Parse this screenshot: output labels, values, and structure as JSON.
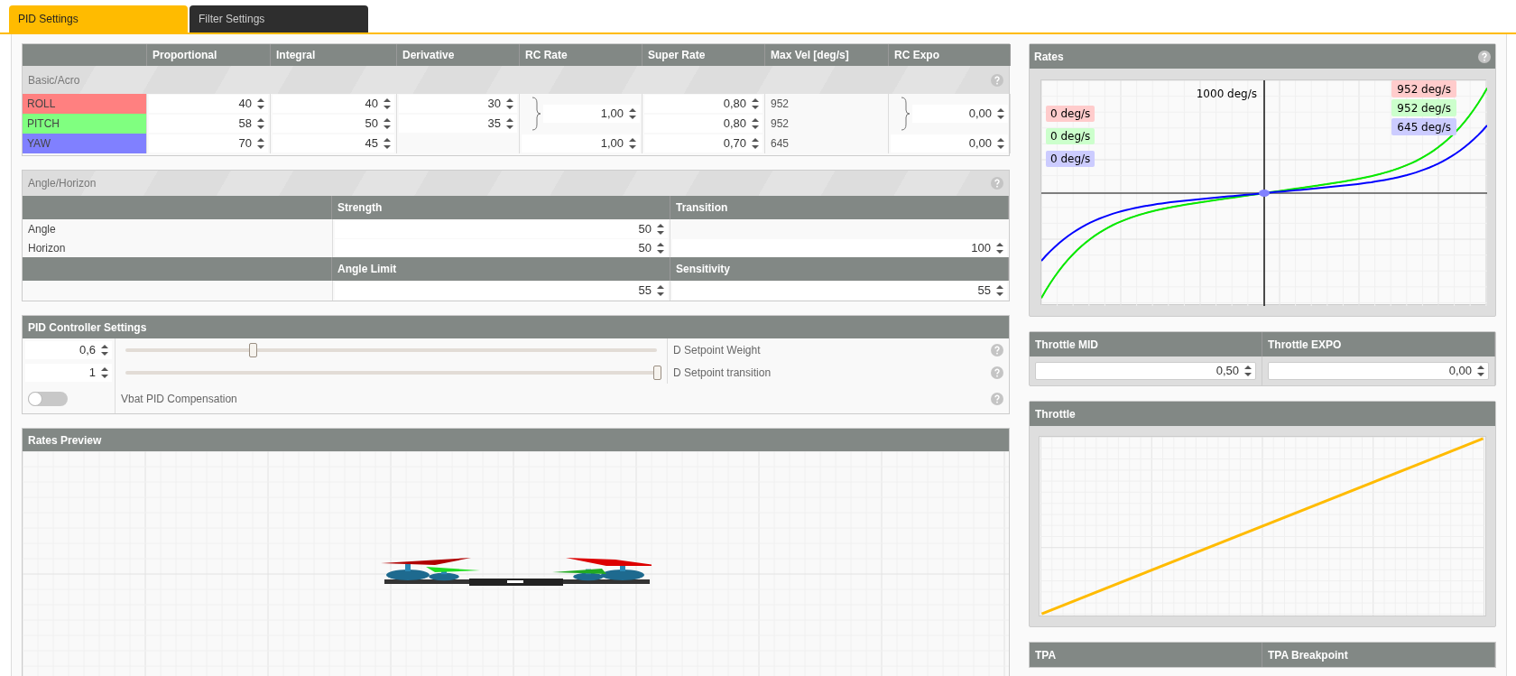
{
  "tabs": [
    {
      "label": "PID Settings",
      "selected": true
    },
    {
      "label": "Filter Settings",
      "selected": false
    }
  ],
  "pid_table": {
    "columns": [
      "Proportional",
      "Integral",
      "Derivative",
      "RC Rate",
      "Super Rate",
      "Max Vel [deg/s]",
      "RC Expo"
    ],
    "section": "Basic/Acro",
    "rows": [
      {
        "axis": "ROLL",
        "color": "#ff8080",
        "proportional": "40",
        "integral": "40",
        "derivative": "30",
        "super_rate": "0,80",
        "max_vel": "952"
      },
      {
        "axis": "PITCH",
        "color": "#80ff80",
        "proportional": "58",
        "integral": "50",
        "derivative": "35",
        "super_rate": "0,80",
        "max_vel": "952"
      },
      {
        "axis": "YAW",
        "color": "#8080ff",
        "proportional": "70",
        "integral": "45",
        "super_rate": "0,70",
        "max_vel": "645"
      }
    ],
    "rc_rate": {
      "roll_pitch": "1,00",
      "yaw": "1,00"
    },
    "rc_expo": {
      "roll_pitch": "0,00",
      "yaw": "0,00"
    }
  },
  "angle_horizon": {
    "title": "Angle/Horizon",
    "columns": [
      "Strength",
      "Transition"
    ],
    "rows": [
      {
        "label": "Angle",
        "strength": "50"
      },
      {
        "label": "Horizon",
        "strength": "50",
        "transition": "100"
      }
    ],
    "limit_columns": [
      "Angle Limit",
      "Sensitivity"
    ],
    "limits": {
      "angle_limit": "55",
      "sensitivity": "55"
    }
  },
  "pid_controller": {
    "title": "PID Controller Settings",
    "items": [
      {
        "kind": "slider",
        "value": "0,6",
        "level": 0.24,
        "label": "D Setpoint Weight"
      },
      {
        "kind": "slider",
        "value": "1",
        "level": 1.0,
        "label": "D Setpoint transition"
      },
      {
        "kind": "toggle",
        "on": false,
        "label": "Vbat PID Compensation"
      }
    ]
  },
  "rates_preview": {
    "title": "Rates Preview"
  },
  "rates": {
    "title": "Rates",
    "axis_label": "1000 deg/s",
    "left_labels": [
      {
        "text": "0 deg/s",
        "color": "#ffcccc"
      },
      {
        "text": "0 deg/s",
        "color": "#ccffcc"
      },
      {
        "text": "0 deg/s",
        "color": "#ccccff"
      }
    ],
    "right_labels": [
      {
        "text": "952 deg/s",
        "color": "#ffcccc"
      },
      {
        "text": "952 deg/s",
        "color": "#ccffcc"
      },
      {
        "text": "645 deg/s",
        "color": "#ccccff"
      }
    ]
  },
  "throttle_settings": {
    "columns": [
      "Throttle MID",
      "Throttle EXPO"
    ],
    "values": [
      "0,50",
      "0,00"
    ]
  },
  "throttle": {
    "title": "Throttle"
  },
  "tpa": {
    "columns": [
      "TPA",
      "TPA Breakpoint"
    ]
  }
}
